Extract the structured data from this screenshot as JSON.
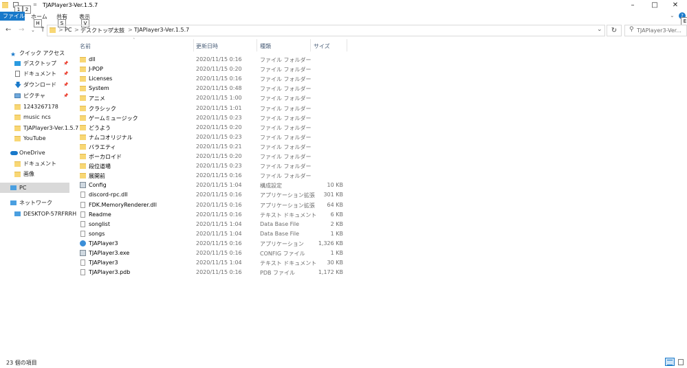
{
  "window": {
    "title": "TJAPlayer3-Ver.1.5.7",
    "qat_keytips": [
      "1",
      "2"
    ],
    "qat_dropdown": "="
  },
  "ribbon": {
    "file_label": "ファイル",
    "tabs": [
      {
        "label": "ホーム",
        "keytip": "H"
      },
      {
        "label": "共有",
        "keytip": "S"
      },
      {
        "label": "表示",
        "keytip": "V"
      }
    ],
    "help_keytip": "E"
  },
  "address": {
    "crumbs": [
      "PC",
      "デスクトップ",
      "太鼓",
      "TJAPlayer3-Ver.1.5.7"
    ],
    "separator": ">"
  },
  "search": {
    "placeholder": "TJAPlayer3-Ver..."
  },
  "nav": {
    "quick_access": "クイック アクセス",
    "items": [
      {
        "label": "デスクトップ",
        "icon": "desktop-icon",
        "pinned": true
      },
      {
        "label": "ドキュメント",
        "icon": "documents-icon",
        "pinned": true
      },
      {
        "label": "ダウンロード",
        "icon": "download-icon",
        "pinned": true
      },
      {
        "label": "ピクチャ",
        "icon": "pictures-icon",
        "pinned": true
      },
      {
        "label": "1243267178",
        "icon": "folder-icon",
        "pinned": false
      },
      {
        "label": "music ncs",
        "icon": "folder-icon",
        "pinned": false
      },
      {
        "label": "TJAPlayer3-Ver.1.5.7",
        "icon": "folder-icon",
        "pinned": false
      },
      {
        "label": "YouTube",
        "icon": "folder-icon",
        "pinned": false
      }
    ],
    "onedrive": "OneDrive",
    "onedrive_items": [
      "ドキュメント",
      "画像"
    ],
    "pc": "PC",
    "network": "ネットワーク",
    "network_items": [
      "DESKTOP-57RFRRH"
    ]
  },
  "columns": {
    "name": "名前",
    "date": "更新日時",
    "type": "種類",
    "size": "サイズ"
  },
  "files": [
    {
      "name": "dll",
      "date": "2020/11/15 0:16",
      "type": "ファイル フォルダー",
      "size": "",
      "kind": "folder"
    },
    {
      "name": "J-POP",
      "date": "2020/11/15 0:20",
      "type": "ファイル フォルダー",
      "size": "",
      "kind": "folder"
    },
    {
      "name": "Licenses",
      "date": "2020/11/15 0:16",
      "type": "ファイル フォルダー",
      "size": "",
      "kind": "folder"
    },
    {
      "name": "System",
      "date": "2020/11/15 0:48",
      "type": "ファイル フォルダー",
      "size": "",
      "kind": "folder"
    },
    {
      "name": "アニメ",
      "date": "2020/11/15 1:00",
      "type": "ファイル フォルダー",
      "size": "",
      "kind": "folder"
    },
    {
      "name": "クラシック",
      "date": "2020/11/15 1:01",
      "type": "ファイル フォルダー",
      "size": "",
      "kind": "folder"
    },
    {
      "name": "ゲームミュージック",
      "date": "2020/11/15 0:23",
      "type": "ファイル フォルダー",
      "size": "",
      "kind": "folder"
    },
    {
      "name": "どうよう",
      "date": "2020/11/15 0:20",
      "type": "ファイル フォルダー",
      "size": "",
      "kind": "folder"
    },
    {
      "name": "ナムコオリジナル",
      "date": "2020/11/15 0:23",
      "type": "ファイル フォルダー",
      "size": "",
      "kind": "folder"
    },
    {
      "name": "バラエティ",
      "date": "2020/11/15 0:21",
      "type": "ファイル フォルダー",
      "size": "",
      "kind": "folder"
    },
    {
      "name": "ボーカロイド",
      "date": "2020/11/15 0:20",
      "type": "ファイル フォルダー",
      "size": "",
      "kind": "folder"
    },
    {
      "name": "段位道場",
      "date": "2020/11/15 0:23",
      "type": "ファイル フォルダー",
      "size": "",
      "kind": "folder"
    },
    {
      "name": "展開前",
      "date": "2020/11/15 0:16",
      "type": "ファイル フォルダー",
      "size": "",
      "kind": "folder"
    },
    {
      "name": "Config",
      "date": "2020/11/15 1:04",
      "type": "構成設定",
      "size": "10 KB",
      "kind": "cfg"
    },
    {
      "name": "discord-rpc.dll",
      "date": "2020/11/15 0:16",
      "type": "アプリケーション拡張",
      "size": "301 KB",
      "kind": "file"
    },
    {
      "name": "FDK.MemoryRenderer.dll",
      "date": "2020/11/15 0:16",
      "type": "アプリケーション拡張",
      "size": "64 KB",
      "kind": "file"
    },
    {
      "name": "Readme",
      "date": "2020/11/15 0:16",
      "type": "テキスト ドキュメント",
      "size": "6 KB",
      "kind": "file"
    },
    {
      "name": "songlist",
      "date": "2020/11/15 1:04",
      "type": "Data Base File",
      "size": "2 KB",
      "kind": "file"
    },
    {
      "name": "songs",
      "date": "2020/11/15 1:04",
      "type": "Data Base File",
      "size": "1 KB",
      "kind": "file"
    },
    {
      "name": "TJAPlayer3",
      "date": "2020/11/15 0:16",
      "type": "アプリケーション",
      "size": "1,326 KB",
      "kind": "app"
    },
    {
      "name": "TJAPlayer3.exe",
      "date": "2020/11/15 0:16",
      "type": "CONFIG ファイル",
      "size": "1 KB",
      "kind": "cfg"
    },
    {
      "name": "TJAPlayer3",
      "date": "2020/11/15 1:04",
      "type": "テキスト ドキュメント",
      "size": "30 KB",
      "kind": "file"
    },
    {
      "name": "TJAPlayer3.pdb",
      "date": "2020/11/15 0:16",
      "type": "PDB ファイル",
      "size": "1,172 KB",
      "kind": "file"
    }
  ],
  "status": {
    "item_count": "23 個の項目"
  }
}
